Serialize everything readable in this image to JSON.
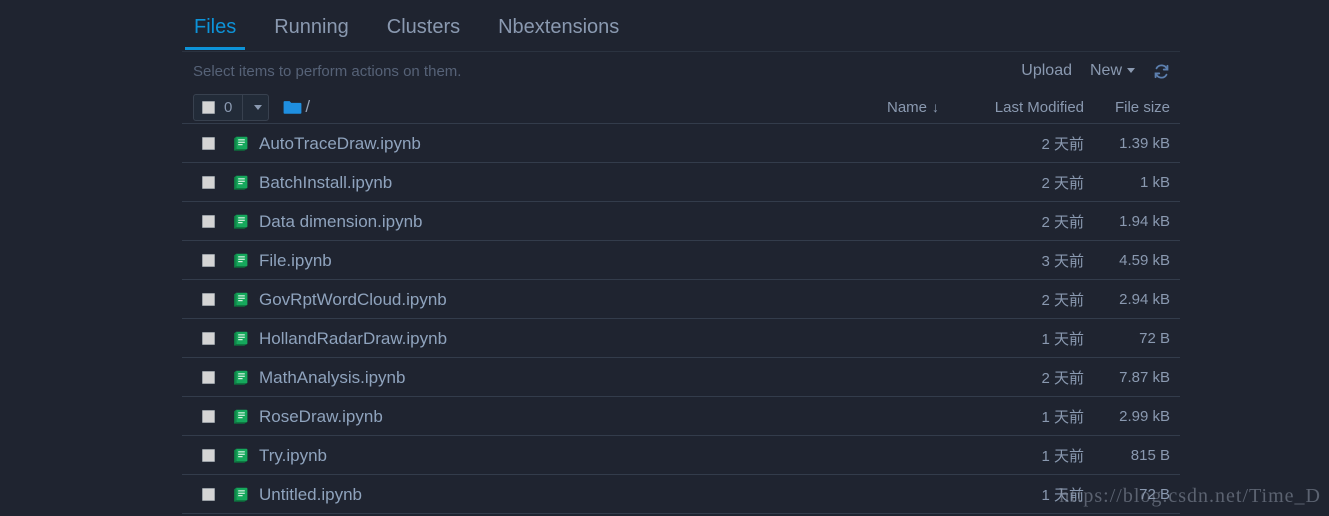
{
  "theme": {
    "background": "#1f2430",
    "accent": "#0d93d8",
    "text_muted": "#8a99b0",
    "hint": "#566277",
    "notebook_icon": "#16a85c",
    "folder_icon": "#1f8fe0",
    "row_divider": "#333c4b"
  },
  "tabs": [
    {
      "label": "Files",
      "active": true
    },
    {
      "label": "Running",
      "active": false
    },
    {
      "label": "Clusters",
      "active": false
    },
    {
      "label": "Nbextensions",
      "active": false
    }
  ],
  "action_bar": {
    "hint": "Select items to perform actions on them.",
    "upload_label": "Upload",
    "new_label": "New",
    "refresh_icon": "refresh-icon",
    "caret_icon": "caret-down-icon"
  },
  "toolbar": {
    "select_all_checkbox": "checkbox",
    "selected_count": "0",
    "dropdown_icon": "caret-down-icon",
    "folder_icon": "folder-icon",
    "breadcrumb_path": "/"
  },
  "columns": {
    "name": "Name",
    "name_sort_arrow": "↓",
    "last_modified": "Last Modified",
    "file_size": "File size"
  },
  "files": [
    {
      "name": "AutoTraceDraw.ipynb",
      "modified": "2 天前",
      "size": "1.39 kB"
    },
    {
      "name": "BatchInstall.ipynb",
      "modified": "2 天前",
      "size": "1 kB"
    },
    {
      "name": "Data dimension.ipynb",
      "modified": "2 天前",
      "size": "1.94 kB"
    },
    {
      "name": "File.ipynb",
      "modified": "3 天前",
      "size": "4.59 kB"
    },
    {
      "name": "GovRptWordCloud.ipynb",
      "modified": "2 天前",
      "size": "2.94 kB"
    },
    {
      "name": "HollandRadarDraw.ipynb",
      "modified": "1 天前",
      "size": "72 B"
    },
    {
      "name": "MathAnalysis.ipynb",
      "modified": "2 天前",
      "size": "7.87 kB"
    },
    {
      "name": "RoseDraw.ipynb",
      "modified": "1 天前",
      "size": "2.99 kB"
    },
    {
      "name": "Try.ipynb",
      "modified": "1 天前",
      "size": "815 B"
    },
    {
      "name": "Untitled.ipynb",
      "modified": "1 天前",
      "size": "72 B"
    }
  ],
  "watermark": "https://blog.csdn.net/Time_D"
}
